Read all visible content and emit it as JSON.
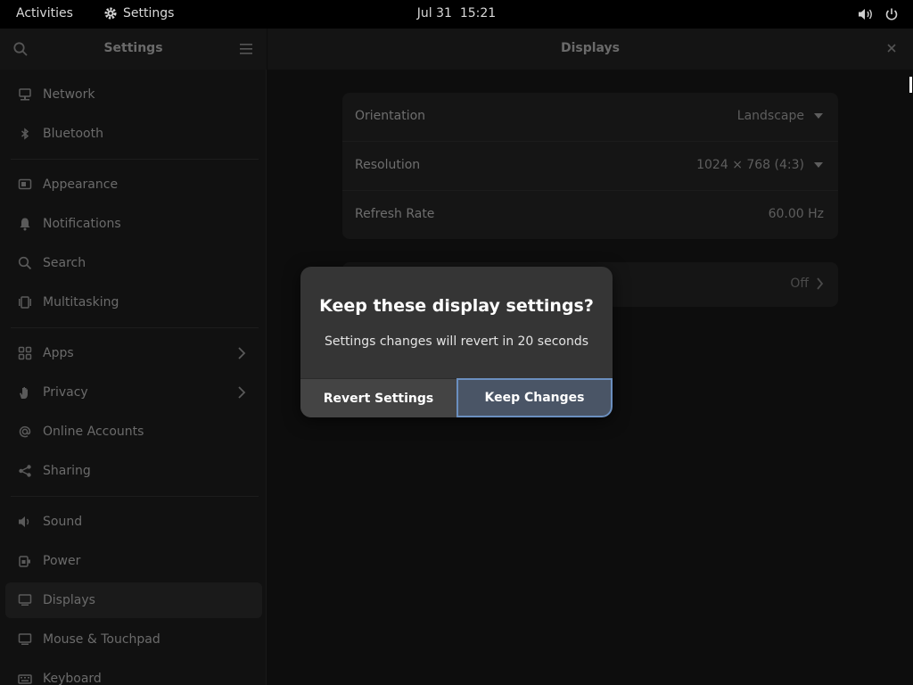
{
  "topbar": {
    "activities": "Activities",
    "app_name": "Settings",
    "app_icon": "gear-icon",
    "date": "Jul 31",
    "time": "15:21",
    "volume_icon": "volume-icon",
    "power_icon": "power-icon"
  },
  "sidebar": {
    "title": "Settings",
    "items": [
      {
        "label": "Network",
        "icon": "network-icon"
      },
      {
        "label": "Bluetooth",
        "icon": "bluetooth-icon"
      },
      {
        "label": "Appearance",
        "icon": "appearance-icon"
      },
      {
        "label": "Notifications",
        "icon": "bell-icon"
      },
      {
        "label": "Search",
        "icon": "search-icon"
      },
      {
        "label": "Multitasking",
        "icon": "multitasking-icon"
      },
      {
        "label": "Apps",
        "icon": "apps-grid-icon"
      },
      {
        "label": "Privacy",
        "icon": "hand-icon"
      },
      {
        "label": "Online Accounts",
        "icon": "at-icon"
      },
      {
        "label": "Sharing",
        "icon": "share-icon"
      },
      {
        "label": "Sound",
        "icon": "sound-icon"
      },
      {
        "label": "Power",
        "icon": "power-plug-icon"
      },
      {
        "label": "Displays",
        "icon": "display-icon"
      },
      {
        "label": "Mouse & Touchpad",
        "icon": "mouse-icon"
      },
      {
        "label": "Keyboard",
        "icon": "keyboard-icon"
      }
    ]
  },
  "main": {
    "title": "Displays",
    "orientation_label": "Orientation",
    "orientation_value": "Landscape",
    "resolution_label": "Resolution",
    "resolution_value": "1024 × 768 (4:3)",
    "refresh_label": "Refresh Rate",
    "refresh_value": "60.00 Hz",
    "night_light_value": "Off"
  },
  "dialog": {
    "title": "Keep these display settings?",
    "body": "Settings changes will revert in 20 seconds",
    "revert": "Revert Settings",
    "keep": "Keep Changes"
  },
  "colors": {
    "accent_border": "#6b8fbf",
    "dialog_bg": "#353535"
  }
}
